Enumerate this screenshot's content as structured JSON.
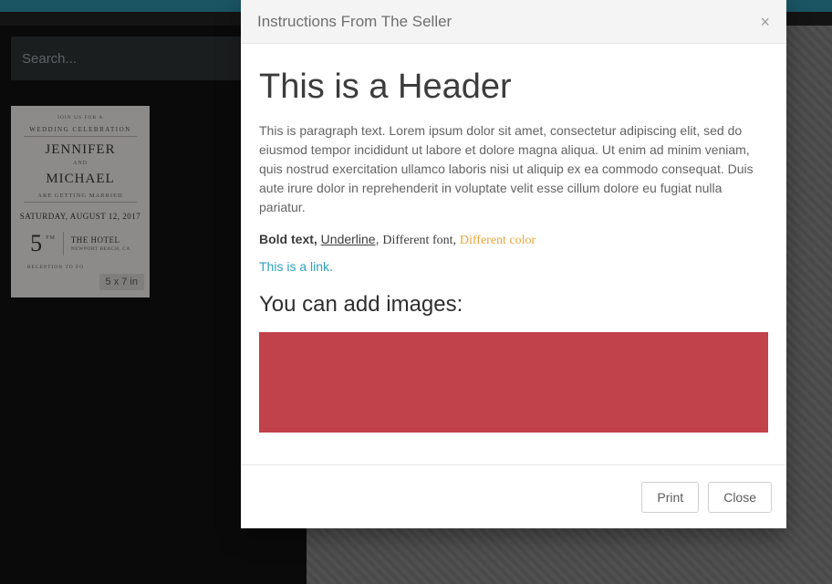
{
  "search": {
    "placeholder": "Search..."
  },
  "card": {
    "joinus": "JOIN US FOR A",
    "label": "WEDDING CELEBRATION",
    "name1": "JENNIFER",
    "and": "AND",
    "name2": "MICHAEL",
    "sub": "ARE GETTING MARRIED",
    "date": "SATURDAY, AUGUST 12, 2017",
    "time_num": "5",
    "time_pm": "PM",
    "hotel": "THE HOTEL",
    "city": "NEWPORT BEACH, CA",
    "reception": "RECEPTION TO FO",
    "size": "5 x 7 in"
  },
  "modal": {
    "title": "Instructions From The Seller",
    "h1": "This is a Header",
    "para": "This is paragraph text. Lorem ipsum dolor sit amet, consectetur adipiscing elit, sed do eiusmod tempor incididunt ut labore et dolore magna aliqua. Ut enim ad minim veniam, quis nostrud exercitation ullamco laboris nisi ut aliquip ex ea commodo consequat. Duis aute irure dolor in reprehenderit in voluptate velit esse cillum dolore eu fugiat nulla pariatur.",
    "bold": "Bold text,",
    "underline": "Underline,",
    "diff_font": "Different font,",
    "diff_color": "Different color",
    "link": "This is a link.",
    "h2": "You can add images:",
    "image_color": "#c1424a",
    "buttons": {
      "print": "Print",
      "close": "Close"
    }
  }
}
